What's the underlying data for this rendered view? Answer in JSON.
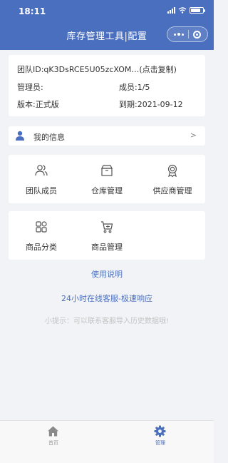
{
  "status_bar": {
    "time": "18:11"
  },
  "nav": {
    "title": "库存管理工具|配置"
  },
  "team": {
    "id_text": "团队ID:qK3DsRCE5U05zcXOM…(点击复制)",
    "admin_label": "管理员:",
    "members_text": "成员:1/5",
    "version_text": "版本:正式版",
    "expiry_text": "到期:2021-09-12"
  },
  "my_info": {
    "icon": "user-icon",
    "label": "我的信息",
    "chevron": ">"
  },
  "grid_row_1": [
    {
      "label": "团队成员",
      "icon": "team-members-icon"
    },
    {
      "label": "仓库管理",
      "icon": "warehouse-box-icon"
    },
    {
      "label": "供应商管理",
      "icon": "supplier-badge-icon"
    }
  ],
  "grid_row_2": [
    {
      "label": "商品分类",
      "icon": "category-grid-icon"
    },
    {
      "label": "商品管理",
      "icon": "product-cart-icon"
    }
  ],
  "links": {
    "usage": "使用说明",
    "service": "24小时在线客服-极速响应"
  },
  "hint": "小提示：可以联系客服导入历史数据哦!",
  "tabbar": {
    "items": [
      {
        "label": "首页",
        "icon": "home-icon"
      },
      {
        "label": "管理",
        "icon": "gear-icon"
      }
    ]
  },
  "colors": {
    "primary": "#4a6fbf",
    "background": "#f2f3f6",
    "hint": "#c4c4c4",
    "tab_inactive": "#999999"
  }
}
